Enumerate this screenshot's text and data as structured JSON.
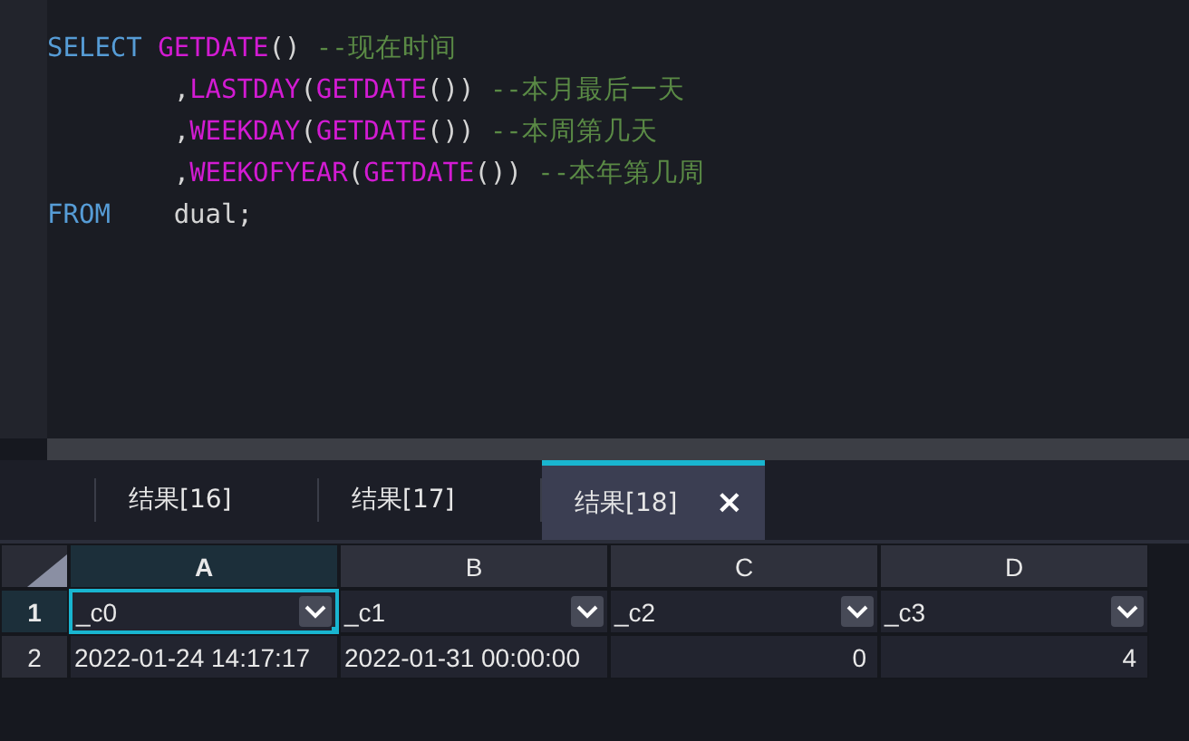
{
  "editor": {
    "lines": [
      [
        {
          "kind": "keyword",
          "text": "SELECT"
        },
        {
          "kind": "function",
          "text": "GETDATE"
        },
        {
          "kind": "plain",
          "text": "() "
        },
        {
          "kind": "comment",
          "text": "--现在时间"
        }
      ],
      [
        {
          "kind": "plain",
          "text": "        ,"
        },
        {
          "kind": "function",
          "text": "LASTDAY"
        },
        {
          "kind": "plain",
          "text": "("
        },
        {
          "kind": "function",
          "text": "GETDATE"
        },
        {
          "kind": "plain",
          "text": "()) "
        },
        {
          "kind": "comment",
          "text": "--本月最后一天"
        }
      ],
      [
        {
          "kind": "plain",
          "text": "        ,"
        },
        {
          "kind": "function",
          "text": "WEEKDAY"
        },
        {
          "kind": "plain",
          "text": "("
        },
        {
          "kind": "function",
          "text": "GETDATE"
        },
        {
          "kind": "plain",
          "text": "()) "
        },
        {
          "kind": "comment",
          "text": "--本周第几天"
        }
      ],
      [
        {
          "kind": "plain",
          "text": "        ,"
        },
        {
          "kind": "function",
          "text": "WEEKOFYEAR"
        },
        {
          "kind": "plain",
          "text": "("
        },
        {
          "kind": "function",
          "text": "GETDATE"
        },
        {
          "kind": "plain",
          "text": "()) "
        },
        {
          "kind": "comment",
          "text": "--本年第几周"
        }
      ],
      [
        {
          "kind": "keyword",
          "text": "FROM"
        },
        {
          "kind": "plain",
          "text": "   dual;"
        }
      ]
    ]
  },
  "tabs": [
    {
      "label": "结果[16]",
      "selected": false
    },
    {
      "label": "结果[17]",
      "selected": false
    },
    {
      "label": "结果[18]",
      "selected": true,
      "close": "×"
    }
  ],
  "grid": {
    "columns": [
      {
        "label": "A",
        "selected": true
      },
      {
        "label": "B",
        "selected": false
      },
      {
        "label": "C",
        "selected": false
      },
      {
        "label": "D",
        "selected": false
      }
    ],
    "rows": [
      {
        "number": "1",
        "selected": true,
        "cells": [
          {
            "kind": "filter",
            "text": "_c0",
            "selected": true
          },
          {
            "kind": "filter",
            "text": "_c1",
            "selected": false
          },
          {
            "kind": "filter",
            "text": "_c2",
            "selected": false
          },
          {
            "kind": "filter",
            "text": "_c3",
            "selected": false
          }
        ]
      },
      {
        "number": "2",
        "selected": false,
        "cells": [
          {
            "kind": "text",
            "text": "2022-01-24 14:17:17",
            "selected": false
          },
          {
            "kind": "text",
            "text": "2022-01-31 00:00:00",
            "selected": false
          },
          {
            "kind": "number",
            "text": "0",
            "selected": false
          },
          {
            "kind": "number",
            "text": "4",
            "selected": false
          }
        ]
      }
    ]
  }
}
